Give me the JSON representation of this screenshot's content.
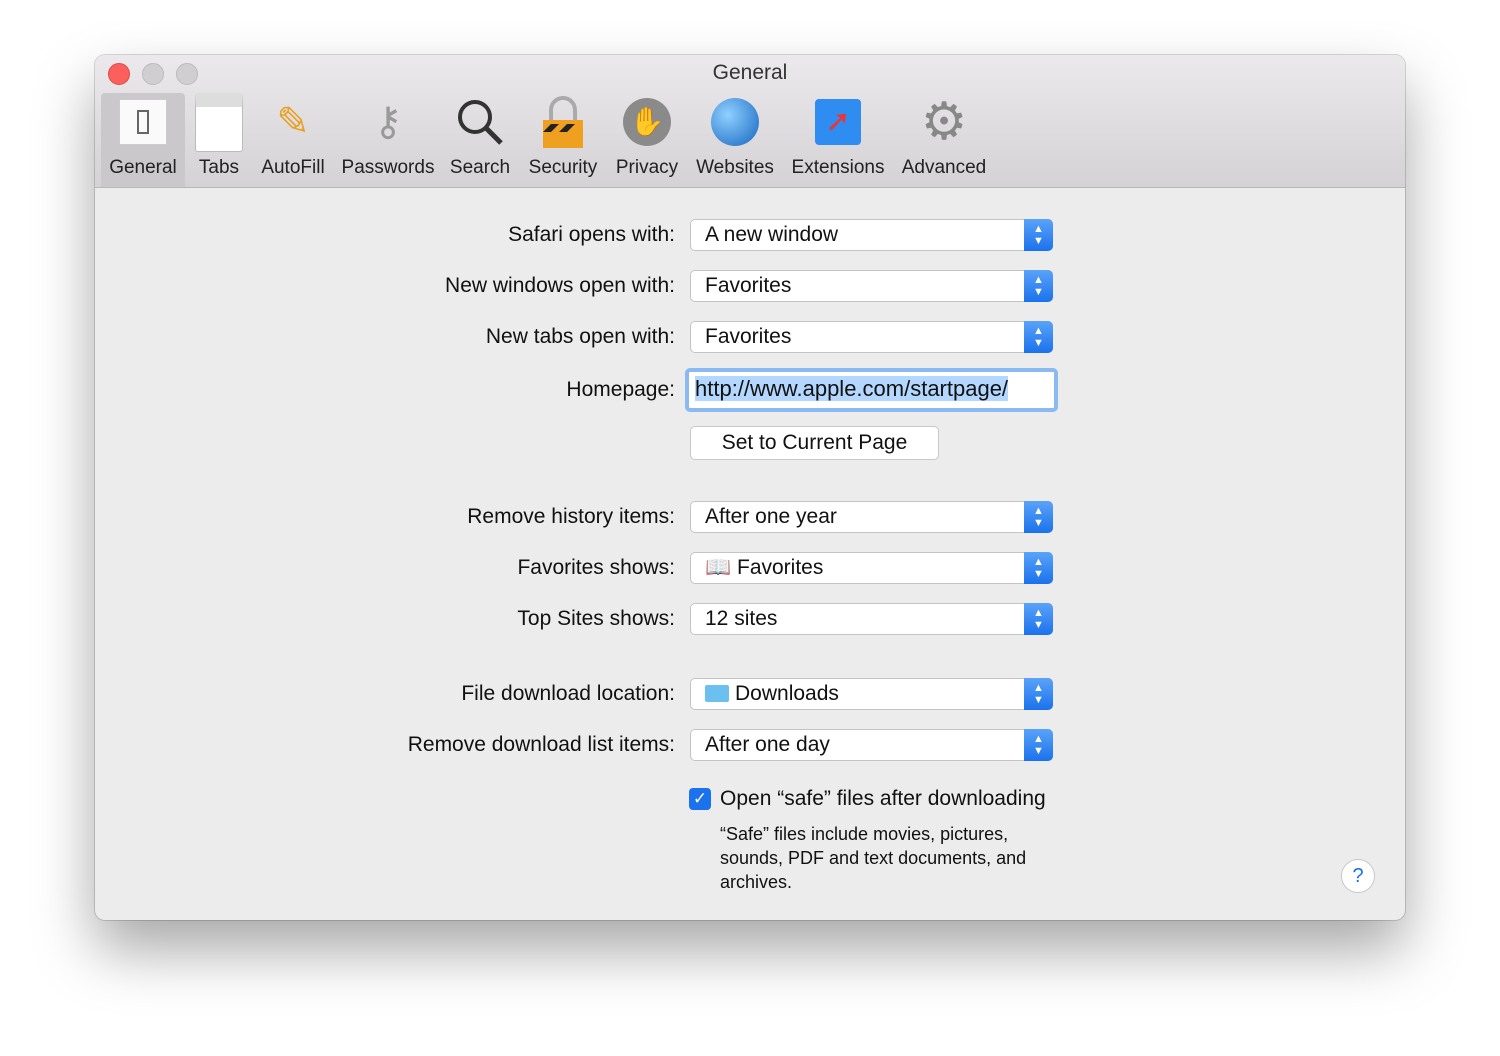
{
  "window": {
    "title": "General"
  },
  "toolbar": [
    {
      "label": "General",
      "icon": "general-switch-icon"
    },
    {
      "label": "Tabs",
      "icon": "tabs-icon"
    },
    {
      "label": "AutoFill",
      "icon": "pencil-icon"
    },
    {
      "label": "Passwords",
      "icon": "key-icon"
    },
    {
      "label": "Search",
      "icon": "magnifier-icon"
    },
    {
      "label": "Security",
      "icon": "lock-icon"
    },
    {
      "label": "Privacy",
      "icon": "hand-icon"
    },
    {
      "label": "Websites",
      "icon": "globe-icon"
    },
    {
      "label": "Extensions",
      "icon": "puzzle-compass-icon"
    },
    {
      "label": "Advanced",
      "icon": "gear-icon"
    }
  ],
  "settings": {
    "safari_opens": {
      "label": "Safari opens with:",
      "value": "A new window"
    },
    "new_windows": {
      "label": "New windows open with:",
      "value": "Favorites"
    },
    "new_tabs": {
      "label": "New tabs open with:",
      "value": "Favorites"
    },
    "homepage": {
      "label": "Homepage:",
      "value": "http://www.apple.com/startpage/"
    },
    "set_current": "Set to Current Page",
    "remove_history": {
      "label": "Remove history items:",
      "value": "After one year"
    },
    "favorites_shows": {
      "label": "Favorites shows:",
      "value": "Favorites"
    },
    "top_sites": {
      "label": "Top Sites shows:",
      "value": "12 sites"
    },
    "download_location": {
      "label": "File download location:",
      "value": "Downloads"
    },
    "remove_downloads": {
      "label": "Remove download list items:",
      "value": "After one day"
    },
    "open_safe": {
      "label": "Open “safe” files after downloading",
      "checked": true
    },
    "safe_note": [
      "“Safe” files include movies, pictures,",
      "sounds, PDF and text documents, and",
      "archives."
    ],
    "help": "?"
  },
  "colors": {
    "accent": "#1a72ec",
    "close": "#fc605c"
  }
}
